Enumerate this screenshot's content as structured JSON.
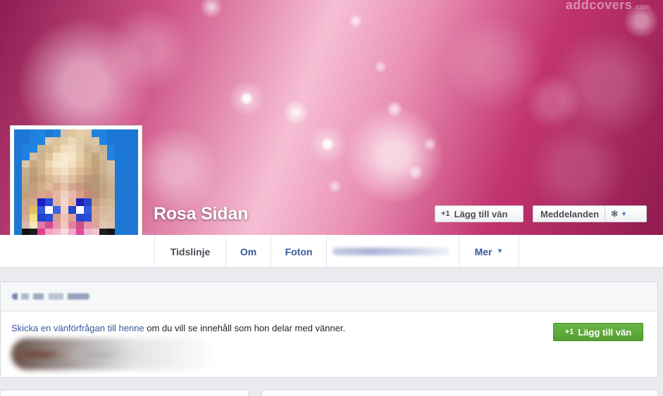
{
  "cover": {
    "watermark_brand": "addcovers",
    "watermark_domain": ".com"
  },
  "profile": {
    "name": "Rosa Sidan"
  },
  "actions": {
    "add_friend": "Lägg till vän",
    "messages": "Meddelanden"
  },
  "tabs": [
    {
      "label": "Tidslinje",
      "active": true
    },
    {
      "label": "Om",
      "active": false
    },
    {
      "label": "Foton",
      "active": false
    },
    {
      "label": "",
      "active": false
    },
    {
      "label": "Mer",
      "active": false
    }
  ],
  "request": {
    "link_text": "Skicka en vänförfrågan till henne",
    "rest_text": " om du vill se innehåll som hon delar med vänner.",
    "button_label": "Lägg till vän"
  },
  "icons": {
    "plus": "+1",
    "gear": "✻",
    "chevron_down": "▼"
  },
  "colors": {
    "link": "#365899",
    "green_button": "#5ca53a",
    "cover_pink": "#cc4f84"
  }
}
